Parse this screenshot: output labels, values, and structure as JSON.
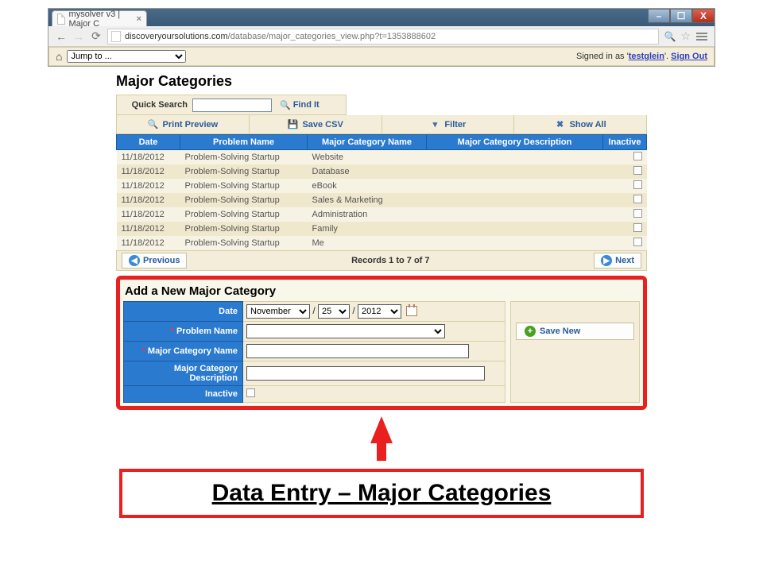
{
  "browser": {
    "tab_title": "mysolver v3 | Major C",
    "url_host": "discoveryoursolutions.com",
    "url_path": "/database/major_categories_view.php?t=1353888602"
  },
  "app_bar": {
    "jump_label": "Jump to ...",
    "signed_in_prefix": "Signed in as '",
    "username": "testglein",
    "signed_in_suffix": "'. ",
    "sign_out": "Sign Out"
  },
  "page": {
    "title": "Major Categories"
  },
  "search": {
    "label": "Quick Search",
    "find_it": "Find It"
  },
  "toolbar": {
    "print_preview": "Print Preview",
    "save_csv": "Save CSV",
    "filter": "Filter",
    "show_all": "Show All"
  },
  "columns": {
    "date": "Date",
    "problem_name": "Problem Name",
    "major_category_name": "Major Category Name",
    "major_category_desc": "Major Category Description",
    "inactive": "Inactive"
  },
  "rows": [
    {
      "date": "11/18/2012",
      "problem": "Problem-Solving Startup",
      "cat": "Website"
    },
    {
      "date": "11/18/2012",
      "problem": "Problem-Solving Startup",
      "cat": "Database"
    },
    {
      "date": "11/18/2012",
      "problem": "Problem-Solving Startup",
      "cat": "eBook"
    },
    {
      "date": "11/18/2012",
      "problem": "Problem-Solving Startup",
      "cat": "Sales & Marketing"
    },
    {
      "date": "11/18/2012",
      "problem": "Problem-Solving Startup",
      "cat": "Administration"
    },
    {
      "date": "11/18/2012",
      "problem": "Problem-Solving Startup",
      "cat": "Family"
    },
    {
      "date": "11/18/2012",
      "problem": "Problem-Solving Startup",
      "cat": "Me"
    }
  ],
  "pager": {
    "previous": "Previous",
    "summary": "Records 1 to 7 of 7",
    "next": "Next"
  },
  "add_form": {
    "title": "Add a New Major Category",
    "labels": {
      "date": "Date",
      "problem_name": "Problem Name",
      "major_category_name": "Major Category Name",
      "major_category_desc": "Major Category Description",
      "inactive": "Inactive"
    },
    "date_value": {
      "month": "November",
      "day": "25",
      "year": "2012"
    },
    "save_new": "Save New"
  },
  "callout": {
    "text": "Data Entry – Major Categories"
  }
}
